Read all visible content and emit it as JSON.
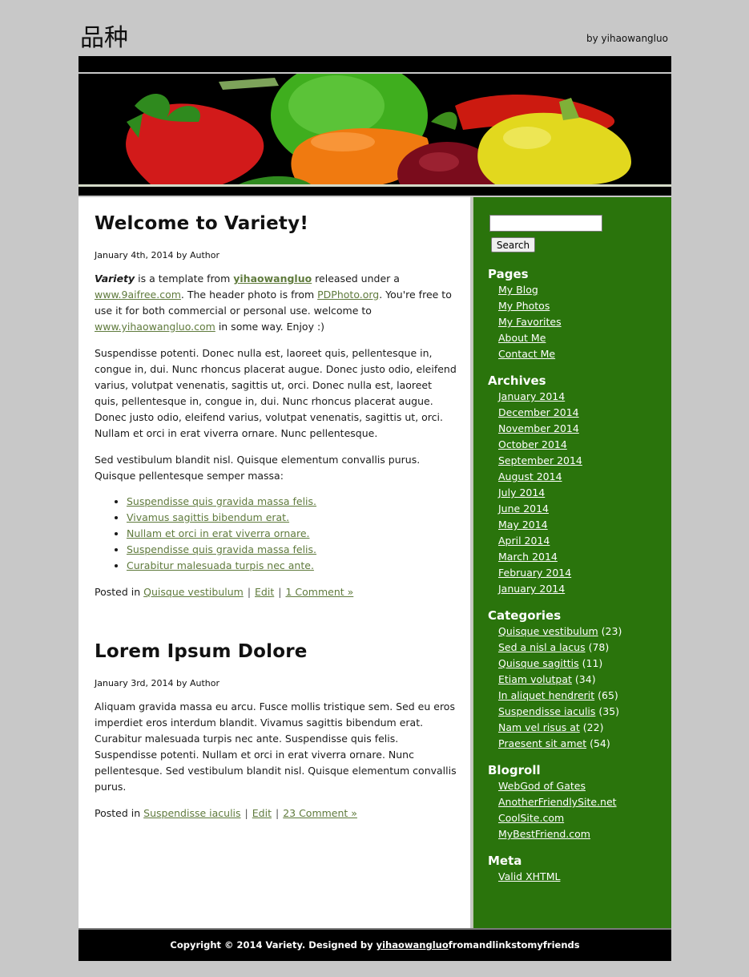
{
  "site": {
    "title": "品种",
    "tagline": "by yihaowangluo"
  },
  "colors": {
    "page_bg": "#c8c8c8",
    "sidebar_bg": "#2a740c",
    "link": "#5f7a3c",
    "bars": "#000000"
  },
  "posts": [
    {
      "title": "Welcome to Variety!",
      "date": "January 4th, 2014",
      "by_label": "by",
      "author": "Author",
      "p1": {
        "brand": "Variety",
        "t1": " is a template from ",
        "link1": "yihaowangluo",
        "t2": " released under a ",
        "link2": "www.9aifree.com",
        "t3": ". The header photo is from ",
        "link3": "PDPhoto.org",
        "t4": ". You're free to use it for both commercial or personal use. welcome to ",
        "link4": "www.yihaowangluo.com",
        "t5": " in some way. Enjoy :)"
      },
      "p2": "Suspendisse potenti. Donec nulla est, laoreet quis, pellentesque in, congue in, dui. Nunc rhoncus placerat augue. Donec justo odio, eleifend varius, volutpat venenatis, sagittis ut, orci. Donec nulla est, laoreet quis, pellentesque in, congue in, dui. Nunc rhoncus placerat augue. Donec justo odio, eleifend varius, volutpat venenatis, sagittis ut, orci. Nullam et orci in erat viverra ornare. Nunc pellentesque.",
      "p3": "Sed vestibulum blandit nisl. Quisque elementum convallis purus. Quisque pellentesque semper massa:",
      "list": [
        "Suspendisse quis gravida massa felis.",
        "Vivamus sagittis bibendum erat.",
        "Nullam et orci in erat viverra ornare.",
        "Suspendisse quis gravida massa felis.",
        "Curabitur malesuada turpis nec ante."
      ],
      "posted_in_label": "Posted in",
      "category": "Quisque vestibulum",
      "edit": "Edit",
      "comments": "1 Comment »"
    },
    {
      "title": "Lorem Ipsum Dolore",
      "date": "January 3rd, 2014",
      "by_label": "by",
      "author": "Author",
      "p1": "Aliquam gravida massa eu arcu. Fusce mollis tristique sem. Sed eu eros imperdiet eros interdum blandit. Vivamus sagittis bibendum erat. Curabitur malesuada turpis nec ante. Suspendisse quis felis. Suspendisse potenti. Nullam et orci in erat viverra ornare. Nunc pellentesque. Sed vestibulum blandit nisl. Quisque elementum convallis purus.",
      "posted_in_label": "Posted in",
      "category": "Suspendisse iaculis",
      "edit": "Edit",
      "comments": "23 Comment »"
    }
  ],
  "sidebar": {
    "search": {
      "value": "",
      "button": "Search"
    },
    "pages": {
      "title": "Pages",
      "items": [
        "My Blog",
        "My Photos",
        "My Favorites",
        "About Me",
        "Contact Me"
      ]
    },
    "archives": {
      "title": "Archives",
      "items": [
        "January 2014",
        "December 2014",
        "November 2014",
        "October 2014",
        "September 2014",
        "August 2014",
        "July 2014",
        "June 2014",
        "May 2014",
        "April 2014",
        "March 2014",
        "February 2014",
        "January 2014"
      ]
    },
    "categories": {
      "title": "Categories",
      "items": [
        {
          "name": "Quisque vestibulum",
          "count": "(23)"
        },
        {
          "name": "Sed a nisl a lacus",
          "count": "(78)"
        },
        {
          "name": "Quisque sagittis",
          "count": "(11)"
        },
        {
          "name": "Etiam volutpat",
          "count": "(34)"
        },
        {
          "name": "In aliquet hendrerit",
          "count": "(65)"
        },
        {
          "name": "Suspendisse iaculis",
          "count": "(35)"
        },
        {
          "name": "Nam vel risus at",
          "count": "(22)"
        },
        {
          "name": "Praesent sit amet",
          "count": "(54)"
        }
      ]
    },
    "blogroll": {
      "title": "Blogroll",
      "items": [
        "WebGod of Gates",
        "AnotherFriendlySite.net",
        "CoolSite.com",
        "MyBestFriend.com"
      ]
    },
    "meta": {
      "title": "Meta",
      "items": [
        "Valid XHTML"
      ]
    }
  },
  "footer": {
    "text": "Copyright © 2014 Variety. Designed by ",
    "link": "yihaowangluo",
    "tail": "fromandlinkstomyfriends"
  }
}
